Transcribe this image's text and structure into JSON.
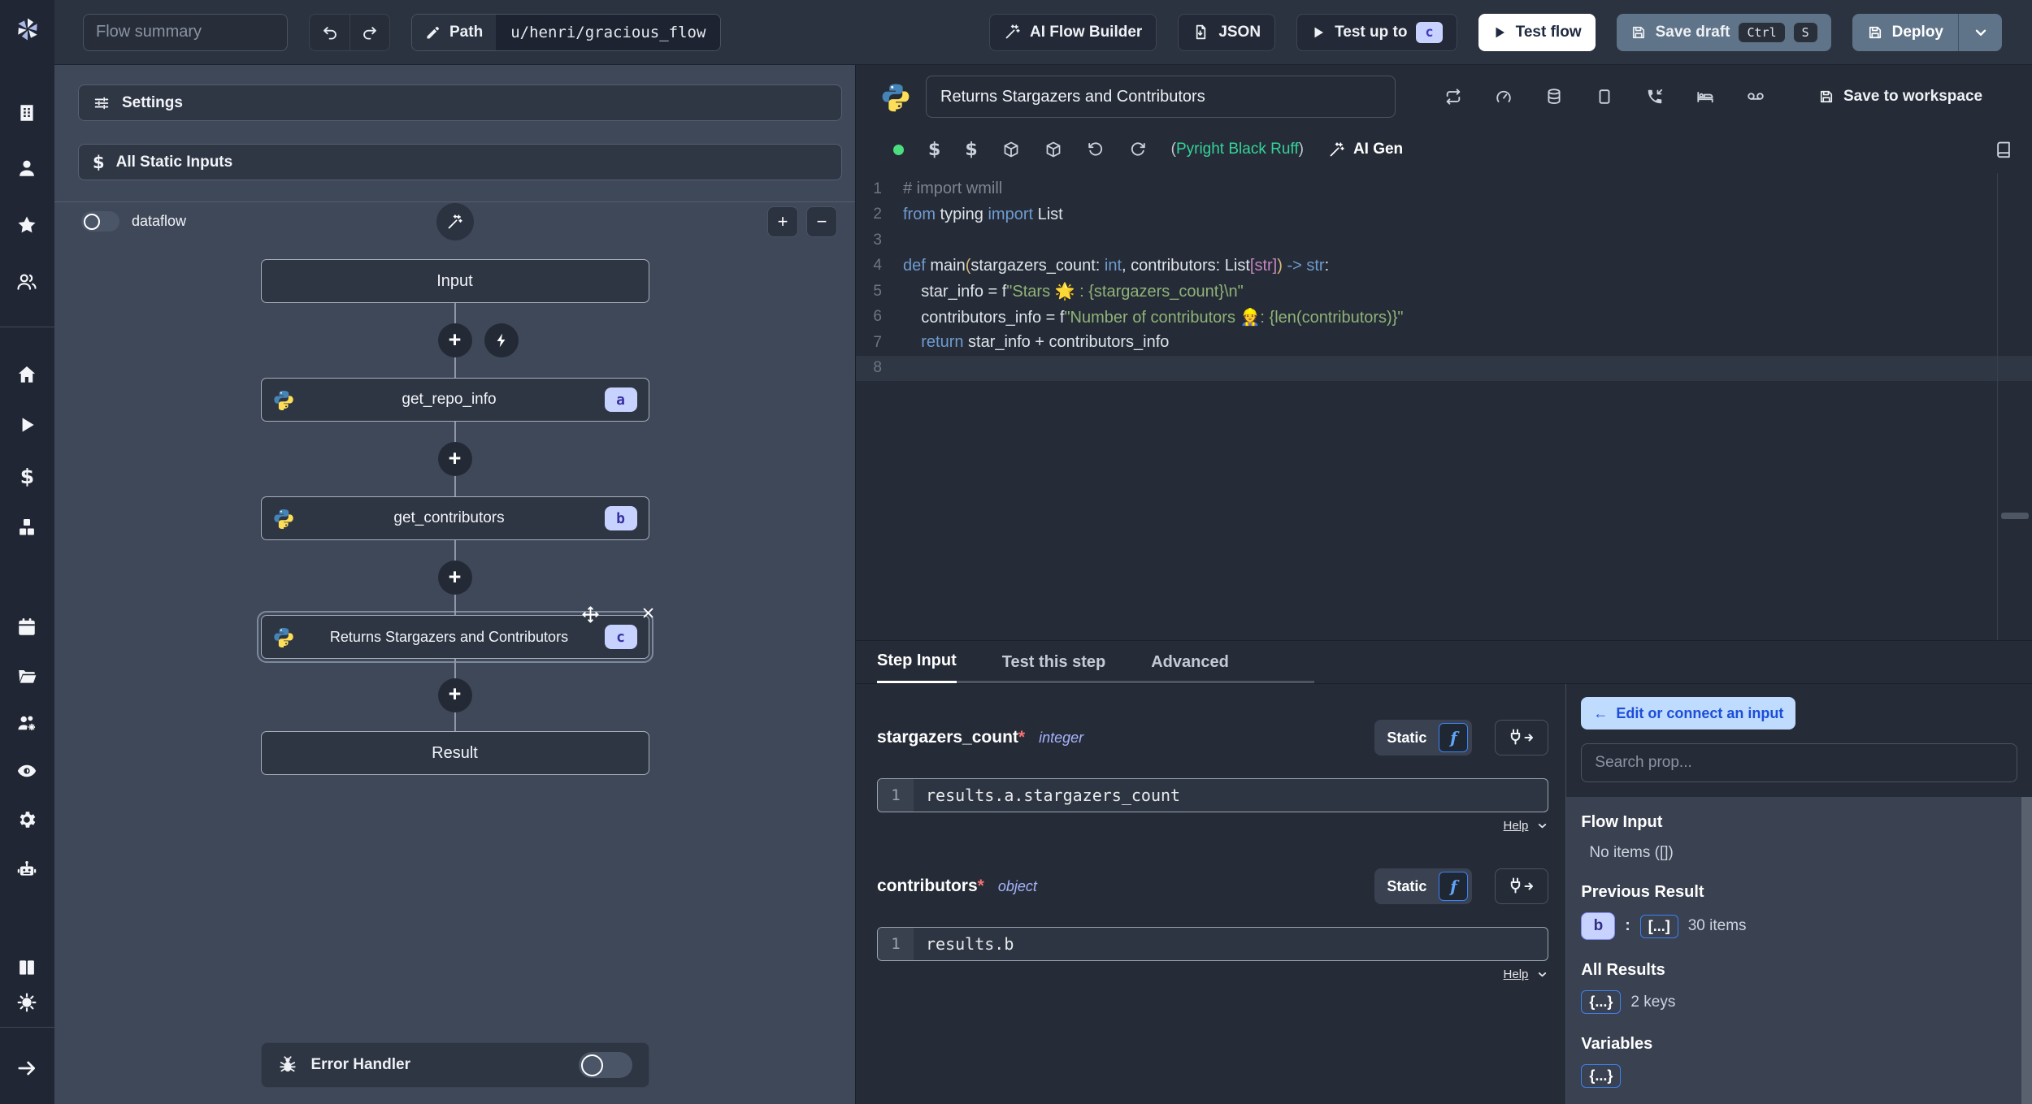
{
  "topbar": {
    "flow_summary_placeholder": "Flow summary",
    "path_label": "Path",
    "path_value": "u/henri/gracious_flow",
    "ai_flow_builder_label": "AI Flow Builder",
    "json_label": "JSON",
    "test_up_to_label": "Test up to",
    "test_up_to_step": "c",
    "test_flow_label": "Test flow",
    "save_draft_label": "Save draft",
    "kbd_ctrl": "Ctrl",
    "kbd_s": "S",
    "deploy_label": "Deploy"
  },
  "sidebar": {
    "icons": [
      "building",
      "user",
      "star",
      "users",
      "home",
      "play",
      "dollar",
      "boxes",
      "calendar",
      "folder",
      "users-gear",
      "eye",
      "gear",
      "robot",
      "books",
      "sun",
      "arrow-right"
    ]
  },
  "flow_panel": {
    "settings_label": "Settings",
    "all_static_inputs_label": "All Static Inputs",
    "dataflow_label": "dataflow",
    "nodes": [
      {
        "kind": "io",
        "label": "Input"
      },
      {
        "kind": "step",
        "label": "get_repo_info",
        "badge": "a"
      },
      {
        "kind": "step",
        "label": "get_contributors",
        "badge": "b"
      },
      {
        "kind": "step",
        "label": "Returns Stargazers and Contributors",
        "badge": "c",
        "selected": true
      },
      {
        "kind": "io",
        "label": "Result"
      }
    ],
    "error_handler_label": "Error Handler"
  },
  "editor": {
    "title_value": "Returns Stargazers and Contributors",
    "save_to_workspace_label": "Save to workspace",
    "assistants_open_paren": "(",
    "assistants_label": "Pyright Black Ruff",
    "assistants_close_paren": ")",
    "ai_gen_label": "AI Gen",
    "code_lines": [
      {
        "n": "1",
        "tokens": [
          [
            "cm",
            "# import wmill"
          ]
        ]
      },
      {
        "n": "2",
        "tokens": [
          [
            "kw",
            "from"
          ],
          [
            "tx",
            " typing "
          ],
          [
            "kw",
            "import"
          ],
          [
            "tx",
            " List"
          ]
        ]
      },
      {
        "n": "3",
        "tokens": []
      },
      {
        "n": "4",
        "tokens": [
          [
            "kw",
            "def"
          ],
          [
            "tx",
            " main"
          ],
          [
            "b1",
            "("
          ],
          [
            "tx",
            "stargazers_count: "
          ],
          [
            "kw",
            "int"
          ],
          [
            "tx",
            ", contributors: List"
          ],
          [
            "b2",
            "[str]"
          ],
          [
            "b1",
            ")"
          ],
          [
            "kw",
            " -> str"
          ],
          [
            "tx",
            ":"
          ]
        ]
      },
      {
        "n": "5",
        "tokens": [
          [
            "tx",
            "    star_info = f"
          ],
          [
            "st",
            "\"Stars "
          ],
          [
            "em",
            "🌟"
          ],
          [
            "st",
            " : {stargazers_count}\\n\""
          ]
        ]
      },
      {
        "n": "6",
        "tokens": [
          [
            "tx",
            "    contributors_info = f"
          ],
          [
            "st",
            "\"Number of contributors "
          ],
          [
            "em",
            "👷"
          ],
          [
            "st",
            ": {len(contributors)}\""
          ]
        ]
      },
      {
        "n": "7",
        "tokens": [
          [
            "kw",
            "    return"
          ],
          [
            "tx",
            " star_info + contributors_info"
          ]
        ]
      },
      {
        "n": "8",
        "active": true,
        "tokens": []
      }
    ]
  },
  "step_panel": {
    "tabs": [
      "Step Input",
      "Test this step",
      "Advanced"
    ],
    "fields": [
      {
        "name": "stargazers_count",
        "required": "*",
        "type": "integer",
        "mode_label": "Static",
        "f_glyph": "f",
        "line_number": "1",
        "expression": "results.a.stargazers_count",
        "help_label": "Help"
      },
      {
        "name": "contributors",
        "required": "*",
        "type": "object",
        "mode_label": "Static",
        "f_glyph": "f",
        "line_number": "1",
        "expression": "results.b",
        "help_label": "Help"
      }
    ]
  },
  "prop_picker": {
    "edit_connect_arrow": "←",
    "edit_connect_label": "Edit or connect an input",
    "search_placeholder": "Search prop...",
    "flow_input_title": "Flow Input",
    "flow_input_empty": "No items ([])",
    "previous_result_title": "Previous Result",
    "previous_result_key": "b",
    "previous_result_colon": ":",
    "previous_result_collapsed": "[...]",
    "previous_result_meta": "30 items",
    "all_results_title": "All Results",
    "all_results_collapsed": "{...}",
    "all_results_meta": "2 keys",
    "variables_title": "Variables",
    "variables_collapsed": "{...}"
  },
  "colors": {
    "accent_blue": "#3b82f6",
    "badge_bg": "#c7d2fe",
    "badge_text": "#3730a3",
    "green_status_dot": "#4ade80",
    "assistant_green": "#34d399",
    "save_button": "#5f7389",
    "edit_connect_bg": "#bfdbfe",
    "edit_connect_text": "#1d4ed8"
  }
}
